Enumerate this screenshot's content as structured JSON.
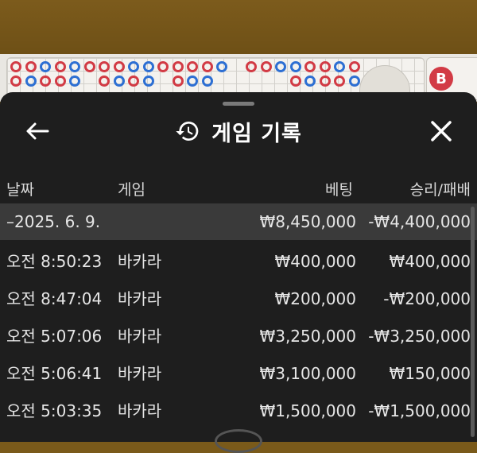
{
  "header": {
    "title": "게임 기록",
    "back_icon": "arrow-left-icon",
    "history_icon": "history-icon",
    "close_icon": "close-icon"
  },
  "background": {
    "badge_label": "B"
  },
  "columns": {
    "date": "날짜",
    "game": "게임",
    "bet": "베팅",
    "win_loss": "승리/패배"
  },
  "date_row": {
    "date": "–2025. 6. 9.",
    "bet": "₩8,450,000",
    "win_loss": "-₩4,400,000"
  },
  "rows": [
    {
      "time": "오전 8:50:23",
      "game": "바카라",
      "bet": "₩400,000",
      "win_loss": "₩400,000"
    },
    {
      "time": "오전 8:47:04",
      "game": "바카라",
      "bet": "₩200,000",
      "win_loss": "-₩200,000"
    },
    {
      "time": "오전 5:07:06",
      "game": "바카라",
      "bet": "₩3,250,000",
      "win_loss": "-₩3,250,000"
    },
    {
      "time": "오전 5:06:41",
      "game": "바카라",
      "bet": "₩3,100,000",
      "win_loss": "₩150,000"
    },
    {
      "time": "오전 5:03:35",
      "game": "바카라",
      "bet": "₩1,500,000",
      "win_loss": "-₩1,500,000"
    }
  ],
  "colors": {
    "sheet_bg": "#1e1e1e",
    "date_row_bg": "#3a3a3a",
    "banker_red": "#d23b45",
    "player_blue": "#2d6fd3"
  }
}
